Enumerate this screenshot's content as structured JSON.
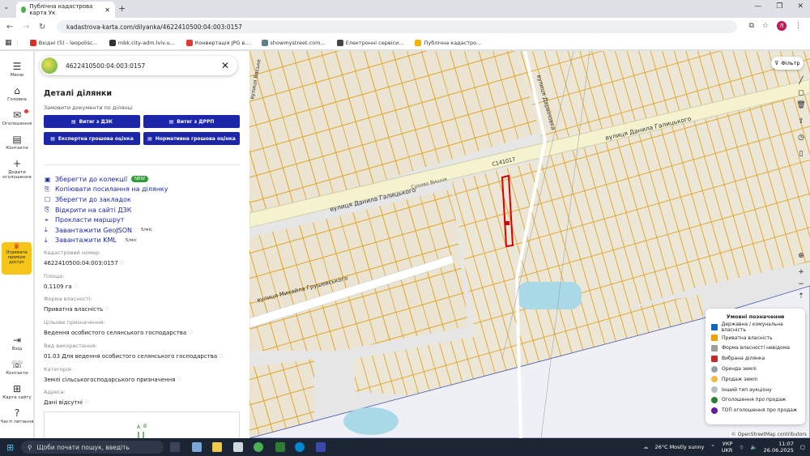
{
  "browser": {
    "tab_title": "Публічна кадастрова карта Ук",
    "url": "kadastrova-karta.com/dilyanka/4622410500:04:003:0157",
    "avatar_letter": "Л",
    "bookmarks": [
      {
        "label": "Вхідні (5) - leopolisc...",
        "color": "#d93025"
      },
      {
        "label": "mbk.city-adm.lviv.u...",
        "color": "#333333"
      },
      {
        "label": "Конвертація JPG в...",
        "color": "#e53935"
      },
      {
        "label": "showmystreet.com...",
        "color": "#607d8b"
      },
      {
        "label": "Електронні сервіси...",
        "color": "#444444"
      },
      {
        "label": "Публічна кадастро...",
        "color": "#f4b400"
      }
    ]
  },
  "nav": [
    {
      "label": "Меню",
      "icon": "menu-icon"
    },
    {
      "label": "Головна",
      "icon": "home-icon"
    },
    {
      "label": "Оголошення",
      "icon": "ads-icon"
    },
    {
      "label": "Контакти",
      "icon": "contacts-icon"
    },
    {
      "label": "Додати оголошення",
      "icon": "add-icon"
    },
    {
      "label": "Отримати преміум доступ",
      "icon": "crown-icon"
    },
    {
      "label": "Вхід",
      "icon": "login-icon"
    },
    {
      "label": "Контакти",
      "icon": "phone-icon"
    },
    {
      "label": "Карта сайту",
      "icon": "sitemap-icon"
    },
    {
      "label": "Часті питання",
      "icon": "help-icon"
    }
  ],
  "panel": {
    "search_value": "4622410500:04:003:0157",
    "title": "Деталі ділянки",
    "order_label": "Замовити документи по ділянці",
    "buttons": [
      "Витяг з ДЗК",
      "Витяг з ДРРП",
      "Експертна грошова оцінка",
      "Нормативна грошова оцінка"
    ],
    "actions": [
      {
        "label": "Зберегти до колекції",
        "badge": "NEW",
        "limit": ""
      },
      {
        "label": "Копіювати посилання на ділянку",
        "badge": "",
        "limit": ""
      },
      {
        "label": "Зберегти до закладок",
        "badge": "",
        "limit": ""
      },
      {
        "label": "Відкрити на сайті ДЗК",
        "badge": "",
        "limit": ""
      },
      {
        "label": "Прокласти маршрут",
        "badge": "",
        "limit": ""
      },
      {
        "label": "Завантажити GeoJSON",
        "badge": "",
        "limit": "5/міс"
      },
      {
        "label": "Завантажити KML",
        "badge": "",
        "limit": "5/міс"
      }
    ],
    "fields": [
      {
        "label": "Кадастровий номер:",
        "value": "4622410500:04:003:0157"
      },
      {
        "label": "Площа:",
        "value": "0.1109 га"
      },
      {
        "label": "Форма власності:",
        "value": "Приватна власність"
      },
      {
        "label": "Цільове призначення:",
        "value": "Ведення особистого селянського господарства"
      },
      {
        "label": "Вид використання:",
        "value": "01.03 Для ведення особистого селянського господарства"
      },
      {
        "label": "Категорія:",
        "value": "Землі сільськогосподарського призначення"
      },
      {
        "label": "Адреса:",
        "value": "Дані відсутні"
      }
    ]
  },
  "map": {
    "filter_label": "Фільтр",
    "streets": [
      "вулиця Данила Галицького",
      "вулиця Данила Галицького",
      "вулиця Михайла Грушевського",
      "вулиця Дарвіновка",
      "вулиця Ваське",
      "Сухова Вишня",
      "С141017"
    ],
    "legend_title": "Умовні позначення",
    "legend": [
      {
        "label": "Державна / комунальна власність",
        "color": "#1565c0",
        "shape": "square"
      },
      {
        "label": "Приватна власність",
        "color": "#f2a000",
        "shape": "square"
      },
      {
        "label": "Форма власності невідома",
        "color": "#9e9e9e",
        "shape": "square"
      },
      {
        "label": "Вибрана ділянка",
        "color": "#c62828",
        "shape": "square"
      },
      {
        "label": "Оренда землі",
        "color": "#90a4ae",
        "shape": "circle"
      },
      {
        "label": "Продаж землі",
        "color": "#f5b642",
        "shape": "circle"
      },
      {
        "label": "Інший тип аукціону",
        "color": "#b0bec5",
        "shape": "circle"
      },
      {
        "label": "Оголошення про продаж",
        "color": "#2e7d32",
        "shape": "circle"
      },
      {
        "label": "ТОП оголошення про продаж",
        "color": "#6a1b9a",
        "shape": "circle"
      }
    ],
    "attribution": "OpenStreetMap contributors"
  },
  "taskbar": {
    "search_placeholder": "Щоби почати пошук, введіть",
    "weather": "26°C  Mostly sunny",
    "lang": "УКР",
    "lang2": "UKR",
    "time": "11:07",
    "date": "26.06.2025"
  }
}
